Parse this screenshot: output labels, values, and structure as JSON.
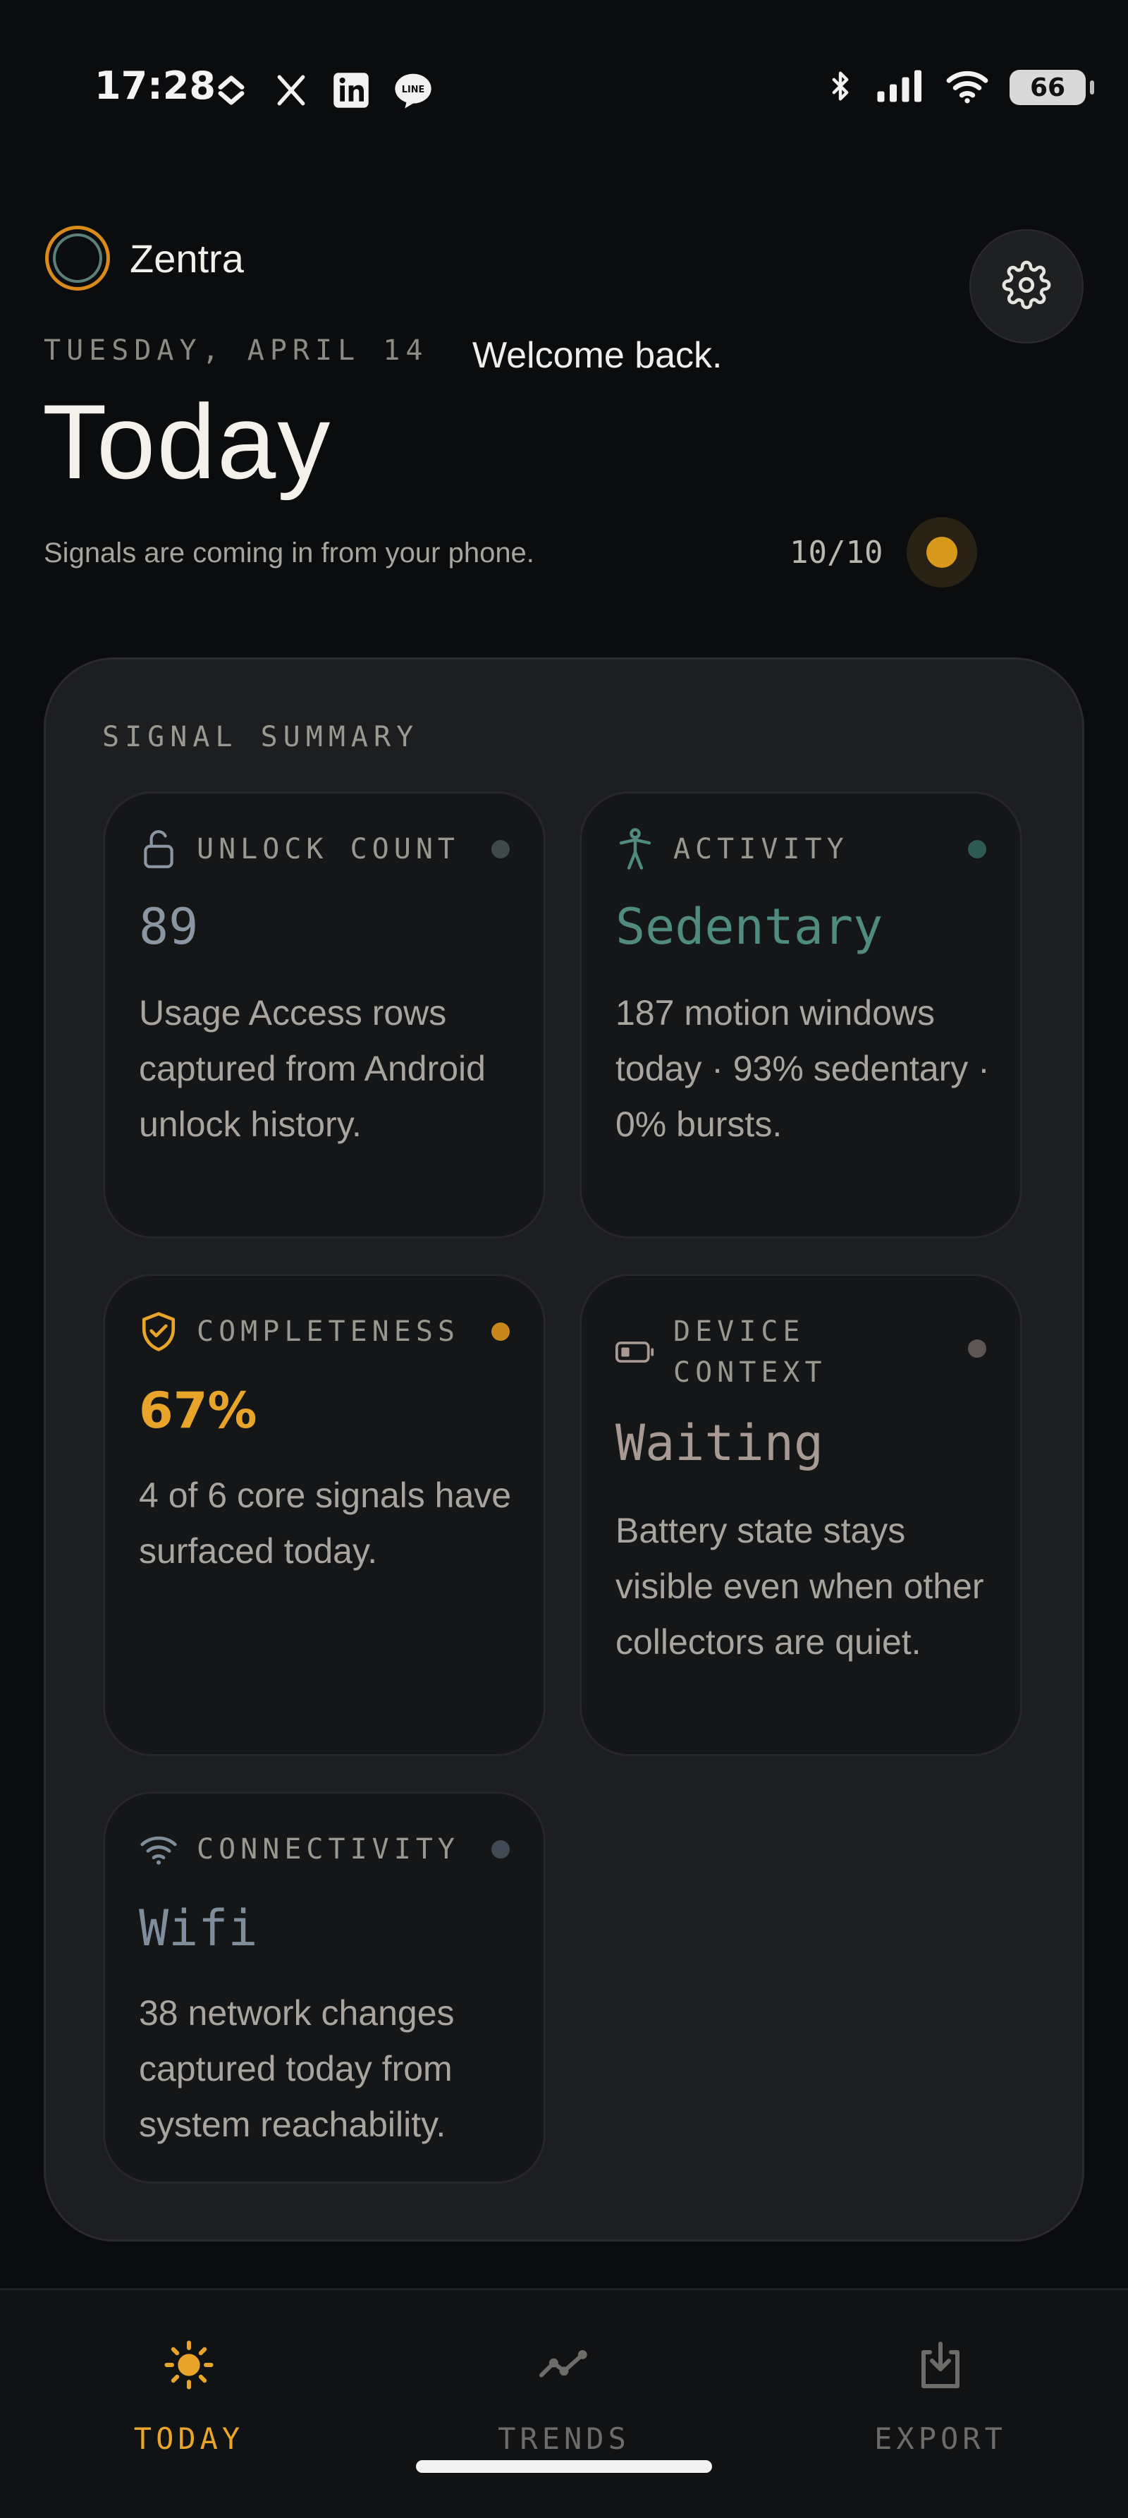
{
  "status_bar": {
    "time": "17:28",
    "battery": "66",
    "left_icons": [
      "chevrons-icon",
      "x-logo-icon",
      "linkedin-icon",
      "line-app-icon"
    ],
    "right_icons": [
      "bluetooth-icon",
      "cellular-signal-icon",
      "wifi-icon",
      "battery-icon"
    ]
  },
  "header": {
    "app_name": "Zentra",
    "date": "TUESDAY, APRIL 14",
    "welcome": "Welcome back.",
    "title": "Today",
    "subtitle": "Signals are coming in from your phone.",
    "score": "10/10"
  },
  "summary": {
    "label": "SIGNAL SUMMARY",
    "cards": [
      {
        "id": "unlock-count",
        "icon": "unlock-icon",
        "label": "UNLOCK COUNT",
        "value": "89",
        "description": "Usage Access rows captured from Android unlock history.",
        "color": "#8a96a3",
        "dot_color": "#3e4a4a"
      },
      {
        "id": "activity",
        "icon": "person-activity-icon",
        "label": "ACTIVITY",
        "value": "Sedentary",
        "description": "187 motion windows today · 93% sedentary · 0% bursts.",
        "color": "#4f8b7e",
        "dot_color": "#2f5a54"
      },
      {
        "id": "completeness",
        "icon": "shield-check-icon",
        "label": "COMPLETENESS",
        "value": "67%",
        "description": "4 of 6 core signals have surfaced today.",
        "color": "#e8a52a",
        "dot_color": "#c8861d"
      },
      {
        "id": "device-context",
        "icon": "battery-low-icon",
        "label_line1": "DEVICE",
        "label_line2": "CONTEXT",
        "value": "Waiting",
        "description": "Battery state stays visible even when other collectors are quiet.",
        "color": "#a89a92",
        "dot_color": "#5e5654"
      },
      {
        "id": "connectivity",
        "icon": "wifi-icon",
        "label": "CONNECTIVITY",
        "value": "Wifi",
        "description": "38 network changes captured today from system reachability.",
        "color": "#7e8e9c",
        "dot_color": "#3f4a54"
      }
    ]
  },
  "nav": {
    "items": [
      {
        "label": "TODAY",
        "icon": "sun-icon",
        "active": true
      },
      {
        "label": "TRENDS",
        "icon": "trend-line-icon",
        "active": false
      },
      {
        "label": "EXPORT",
        "icon": "export-download-icon",
        "active": false
      }
    ],
    "active_color": "#e8a52a",
    "inactive_color": "#6e6c69"
  }
}
